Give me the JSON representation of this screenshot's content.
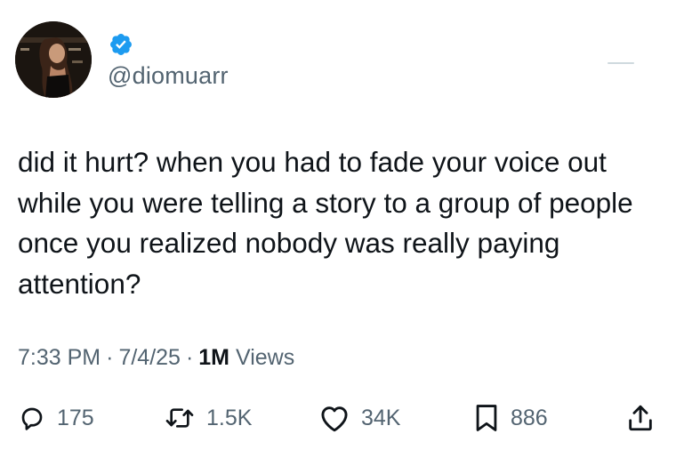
{
  "author": {
    "handle": "@diomuarr",
    "verified": true,
    "verified_color": "#1d9bf0",
    "avatar_icon": "profile-photo"
  },
  "tweet": {
    "text": "did it hurt? when you had to fade your voice out\nwhile you were telling a story to a group of people\nonce you realized nobody was really paying\nattention?"
  },
  "meta": {
    "time": "7:33 PM",
    "separator": "·",
    "date": "7/4/25",
    "views_count": "1M",
    "views_label": "Views"
  },
  "actions": {
    "replies": {
      "icon": "reply-icon",
      "count": "175"
    },
    "reposts": {
      "icon": "repost-icon",
      "count": "1.5K"
    },
    "likes": {
      "icon": "heart-icon",
      "count": "34K"
    },
    "bookmarks": {
      "icon": "bookmark-icon",
      "count": "886"
    },
    "share": {
      "icon": "share-icon"
    }
  },
  "colors": {
    "text_primary": "#0f1419",
    "text_secondary": "#536471",
    "icon": "#536471"
  }
}
